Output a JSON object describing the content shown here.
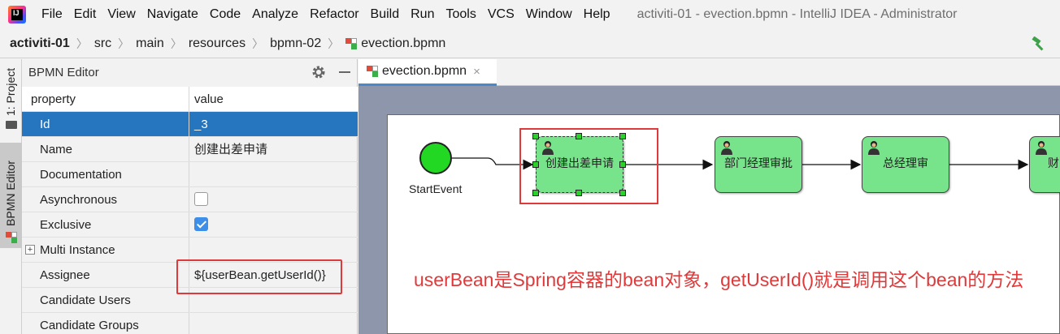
{
  "menubar": {
    "items": [
      "File",
      "Edit",
      "View",
      "Navigate",
      "Code",
      "Analyze",
      "Refactor",
      "Build",
      "Run",
      "Tools",
      "VCS",
      "Window",
      "Help"
    ],
    "window_title": "activiti-01 - evection.bpmn - IntelliJ IDEA - Administrator"
  },
  "breadcrumb": {
    "items": [
      "activiti-01",
      "src",
      "main",
      "resources",
      "bpmn-02",
      "evection.bpmn"
    ]
  },
  "toolstrip": {
    "project_label": "1: Project",
    "bpmn_label": "BPMN Editor"
  },
  "panel": {
    "title": "BPMN Editor",
    "header": {
      "property": "property",
      "value": "value"
    },
    "rows": [
      {
        "property": "Id",
        "value": "_3"
      },
      {
        "property": "Name",
        "value": "创建出差申请"
      },
      {
        "property": "Documentation",
        "value": ""
      },
      {
        "property": "Asynchronous",
        "value": ""
      },
      {
        "property": "Exclusive",
        "value": ""
      },
      {
        "property": "Multi Instance",
        "value": ""
      },
      {
        "property": "Assignee",
        "value": "${userBean.getUserId()}"
      },
      {
        "property": "Candidate Users",
        "value": ""
      },
      {
        "property": "Candidate Groups",
        "value": ""
      }
    ],
    "asynchronous_checked": false,
    "exclusive_checked": true
  },
  "editor": {
    "tab_label": "evection.bpmn",
    "tab_close": "×"
  },
  "diagram": {
    "start_label": "StartEvent",
    "tasks": [
      "创建出差申请",
      "部门经理审批",
      "总经理审",
      "财"
    ],
    "note": "userBean是Spring容器的bean对象，getUserId()就是调用这个bean的方法"
  },
  "colors": {
    "selection": "#2675bf",
    "task_fill": "#77e38a",
    "highlight": "#e0393a",
    "start_fill": "#22d822"
  }
}
